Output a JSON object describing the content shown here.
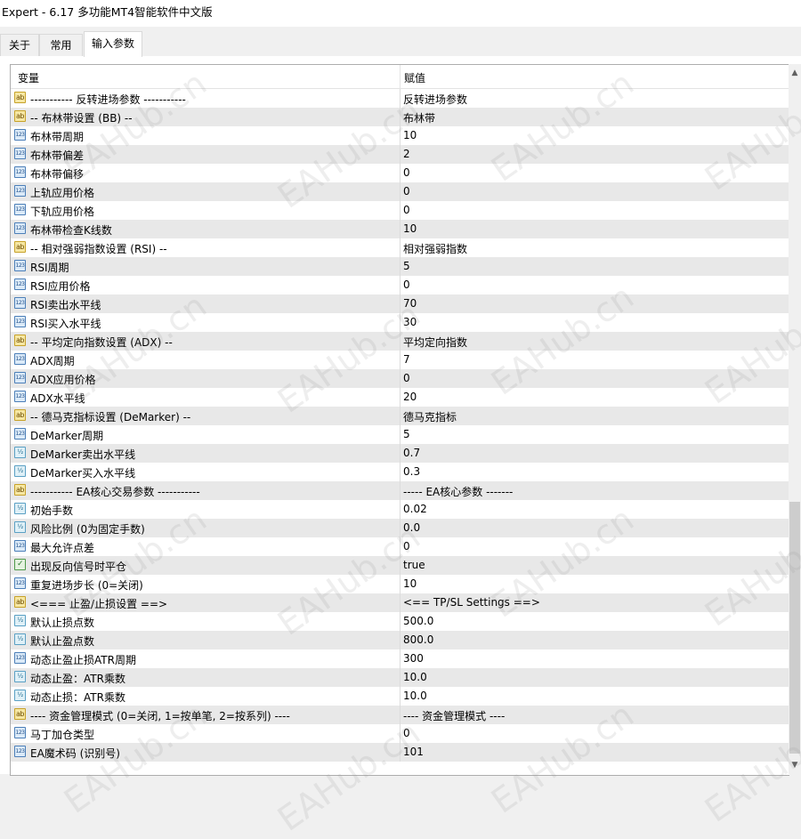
{
  "window": {
    "title": "Expert - 6.17 多功能MT4智能软件中文版"
  },
  "tabs": [
    {
      "label": "关于",
      "active": false
    },
    {
      "label": "常用",
      "active": false
    },
    {
      "label": "输入参数",
      "active": true
    }
  ],
  "table": {
    "headers": {
      "variable": "变量",
      "value": "赋值"
    },
    "rows": [
      {
        "type": "ab",
        "name": "----------- 反转进场参数 -----------",
        "value": "反转进场参数"
      },
      {
        "type": "ab",
        "name": "-- 布林带设置 (BB) --",
        "value": "布林带"
      },
      {
        "type": "int",
        "name": "布林带周期",
        "value": "10"
      },
      {
        "type": "int",
        "name": "布林带偏差",
        "value": "2"
      },
      {
        "type": "int",
        "name": "布林带偏移",
        "value": "0"
      },
      {
        "type": "int",
        "name": "上轨应用价格",
        "value": "0"
      },
      {
        "type": "int",
        "name": "下轨应用价格",
        "value": "0"
      },
      {
        "type": "int",
        "name": "布林带检查K线数",
        "value": "10"
      },
      {
        "type": "ab",
        "name": "-- 相对强弱指数设置 (RSI) --",
        "value": "相对强弱指数"
      },
      {
        "type": "int",
        "name": "RSI周期",
        "value": "5"
      },
      {
        "type": "int",
        "name": "RSI应用价格",
        "value": "0"
      },
      {
        "type": "int",
        "name": "RSI卖出水平线",
        "value": "70"
      },
      {
        "type": "int",
        "name": "RSI买入水平线",
        "value": "30"
      },
      {
        "type": "ab",
        "name": "-- 平均定向指数设置 (ADX) --",
        "value": "平均定向指数"
      },
      {
        "type": "int",
        "name": "ADX周期",
        "value": "7"
      },
      {
        "type": "int",
        "name": "ADX应用价格",
        "value": "0"
      },
      {
        "type": "int",
        "name": "ADX水平线",
        "value": "20"
      },
      {
        "type": "ab",
        "name": "-- 德马克指标设置 (DeMarker) --",
        "value": "德马克指标"
      },
      {
        "type": "int",
        "name": "DeMarker周期",
        "value": "5"
      },
      {
        "type": "dbl",
        "name": "DeMarker卖出水平线",
        "value": "0.7"
      },
      {
        "type": "dbl",
        "name": "DeMarker买入水平线",
        "value": "0.3"
      },
      {
        "type": "ab",
        "name": "----------- EA核心交易参数 -----------",
        "value": "----- EA核心参数 -------"
      },
      {
        "type": "dbl",
        "name": "初始手数",
        "value": "0.02"
      },
      {
        "type": "dbl",
        "name": "风险比例 (0为固定手数)",
        "value": "0.0"
      },
      {
        "type": "int",
        "name": "最大允许点差",
        "value": "0"
      },
      {
        "type": "bool",
        "name": "出现反向信号时平仓",
        "value": "true"
      },
      {
        "type": "int",
        "name": "重复进场步长 (0=关闭)",
        "value": "10"
      },
      {
        "type": "ab",
        "name": "<=== 止盈/止损设置 ==>",
        "value": "<== TP/SL Settings ==>"
      },
      {
        "type": "dbl",
        "name": "默认止损点数",
        "value": "500.0"
      },
      {
        "type": "dbl",
        "name": "默认止盈点数",
        "value": "800.0"
      },
      {
        "type": "int",
        "name": "动态止盈止损ATR周期",
        "value": "300"
      },
      {
        "type": "dbl",
        "name": "动态止盈：ATR乘数",
        "value": "10.0"
      },
      {
        "type": "dbl",
        "name": "动态止损：ATR乘数",
        "value": "10.0"
      },
      {
        "type": "ab",
        "name": "---- 资金管理模式 (0=关闭, 1=按单笔, 2=按系列) ----",
        "value": "---- 资金管理模式 ----"
      },
      {
        "type": "int",
        "name": "马丁加仓类型",
        "value": "0"
      },
      {
        "type": "int",
        "name": "EA魔术码 (识别号)",
        "value": "101"
      }
    ]
  },
  "icons": {
    "ab": {
      "name": "string-param-icon",
      "glyph": "ab"
    },
    "int": {
      "name": "integer-param-icon",
      "glyph": "123"
    },
    "dbl": {
      "name": "double-param-icon",
      "glyph": "½"
    },
    "bool": {
      "name": "bool-param-icon",
      "glyph": "✓"
    }
  },
  "watermark": "EAHub.cn"
}
